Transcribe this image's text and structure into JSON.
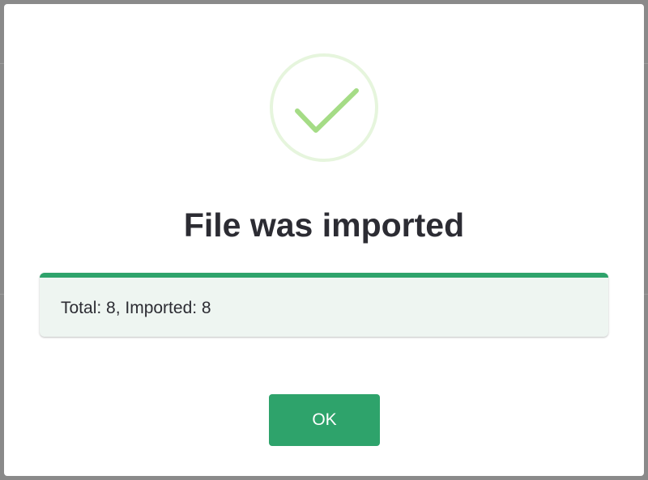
{
  "dialog": {
    "icon": "success-checkmark-icon",
    "title": "File was imported",
    "message": "Total: 8, Imported: 8",
    "ok_label": "OK"
  },
  "colors": {
    "accent": "#2ea36b",
    "checkmark": "#a5dc86",
    "message_bg": "#eef5f1",
    "title_text": "#2c2c33"
  }
}
